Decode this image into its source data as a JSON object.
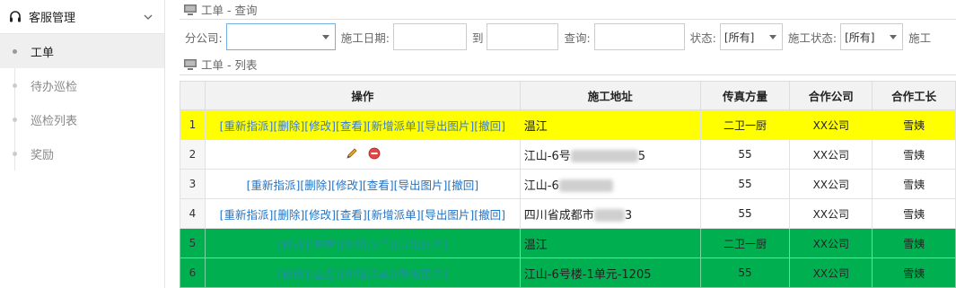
{
  "sidebar": {
    "header": {
      "title": "客服管理",
      "icon": "headset-icon"
    },
    "items": [
      {
        "label": "工单",
        "active": true
      },
      {
        "label": "待办巡检",
        "active": false
      },
      {
        "label": "巡检列表",
        "active": false
      },
      {
        "label": "奖励",
        "active": false
      }
    ]
  },
  "query_panel": {
    "title": "工单 - 查询"
  },
  "filters": {
    "branch_label": "分公司:",
    "branch_value": "",
    "date_label": "施工日期:",
    "to_label": "到",
    "search_label": "查询:",
    "status_label": "状态:",
    "status_value": "[所有]",
    "work_status_label": "施工状态:",
    "work_status_value": "[所有]",
    "trailing_label": "施工"
  },
  "list_panel": {
    "title": "工单 - 列表"
  },
  "table": {
    "headers": [
      "操作",
      "施工地址",
      "传真方量",
      "合作公司",
      "合作工长"
    ],
    "rows": [
      {
        "index": "1",
        "ops": [
          "[重新指派]",
          "[删除]",
          "[修改]",
          "[查看]",
          "[新增派单]",
          "[导出图片]",
          "[撤回]"
        ],
        "address": "温江",
        "volume": "二卫一厨",
        "company": "XX公司",
        "foreman": "雪姨",
        "style": "yellow"
      },
      {
        "index": "2",
        "ops": [],
        "address": "江山-6号",
        "address_tail": "5",
        "volume": "55",
        "company": "XX公司",
        "foreman": "雪姨",
        "style": "white",
        "icons": [
          "pencil-icon",
          "delete-icon"
        ]
      },
      {
        "index": "3",
        "ops": [
          "[重新指派]",
          "[删除]",
          "[修改]",
          "[查看]",
          "[导出图片]",
          "[撤回]"
        ],
        "address": "江山-6",
        "address_tail": "",
        "volume": "55",
        "company": "XX公司",
        "foreman": "雪姨",
        "style": "white"
      },
      {
        "index": "4",
        "ops": [
          "[重新指派]",
          "[删除]",
          "[修改]",
          "[查看]",
          "[新增派单]",
          "[导出图片]",
          "[撤回]"
        ],
        "address": "四川省成都市",
        "address_tail": "3",
        "volume": "55",
        "company": "XX公司",
        "foreman": "雪姨",
        "style": "white"
      },
      {
        "index": "5",
        "ops": [
          "[修改]",
          "[查看]",
          "[新增派单]",
          "[导出图片]"
        ],
        "address": "温江",
        "volume": "二卫一厨",
        "company": "XX公司",
        "foreman": "雪姨",
        "style": "green"
      },
      {
        "index": "6",
        "ops": [
          "[修改]",
          "[查看]",
          "[新增派单]",
          "[导出图片]"
        ],
        "address": "江山-6号楼-1单元-1205",
        "volume": "55",
        "company": "XX公司",
        "foreman": "雪姨",
        "style": "green"
      }
    ]
  },
  "colors": {
    "yellow_row": "#ffff00",
    "green_row": "#00b050",
    "link": "#1f73c6"
  }
}
